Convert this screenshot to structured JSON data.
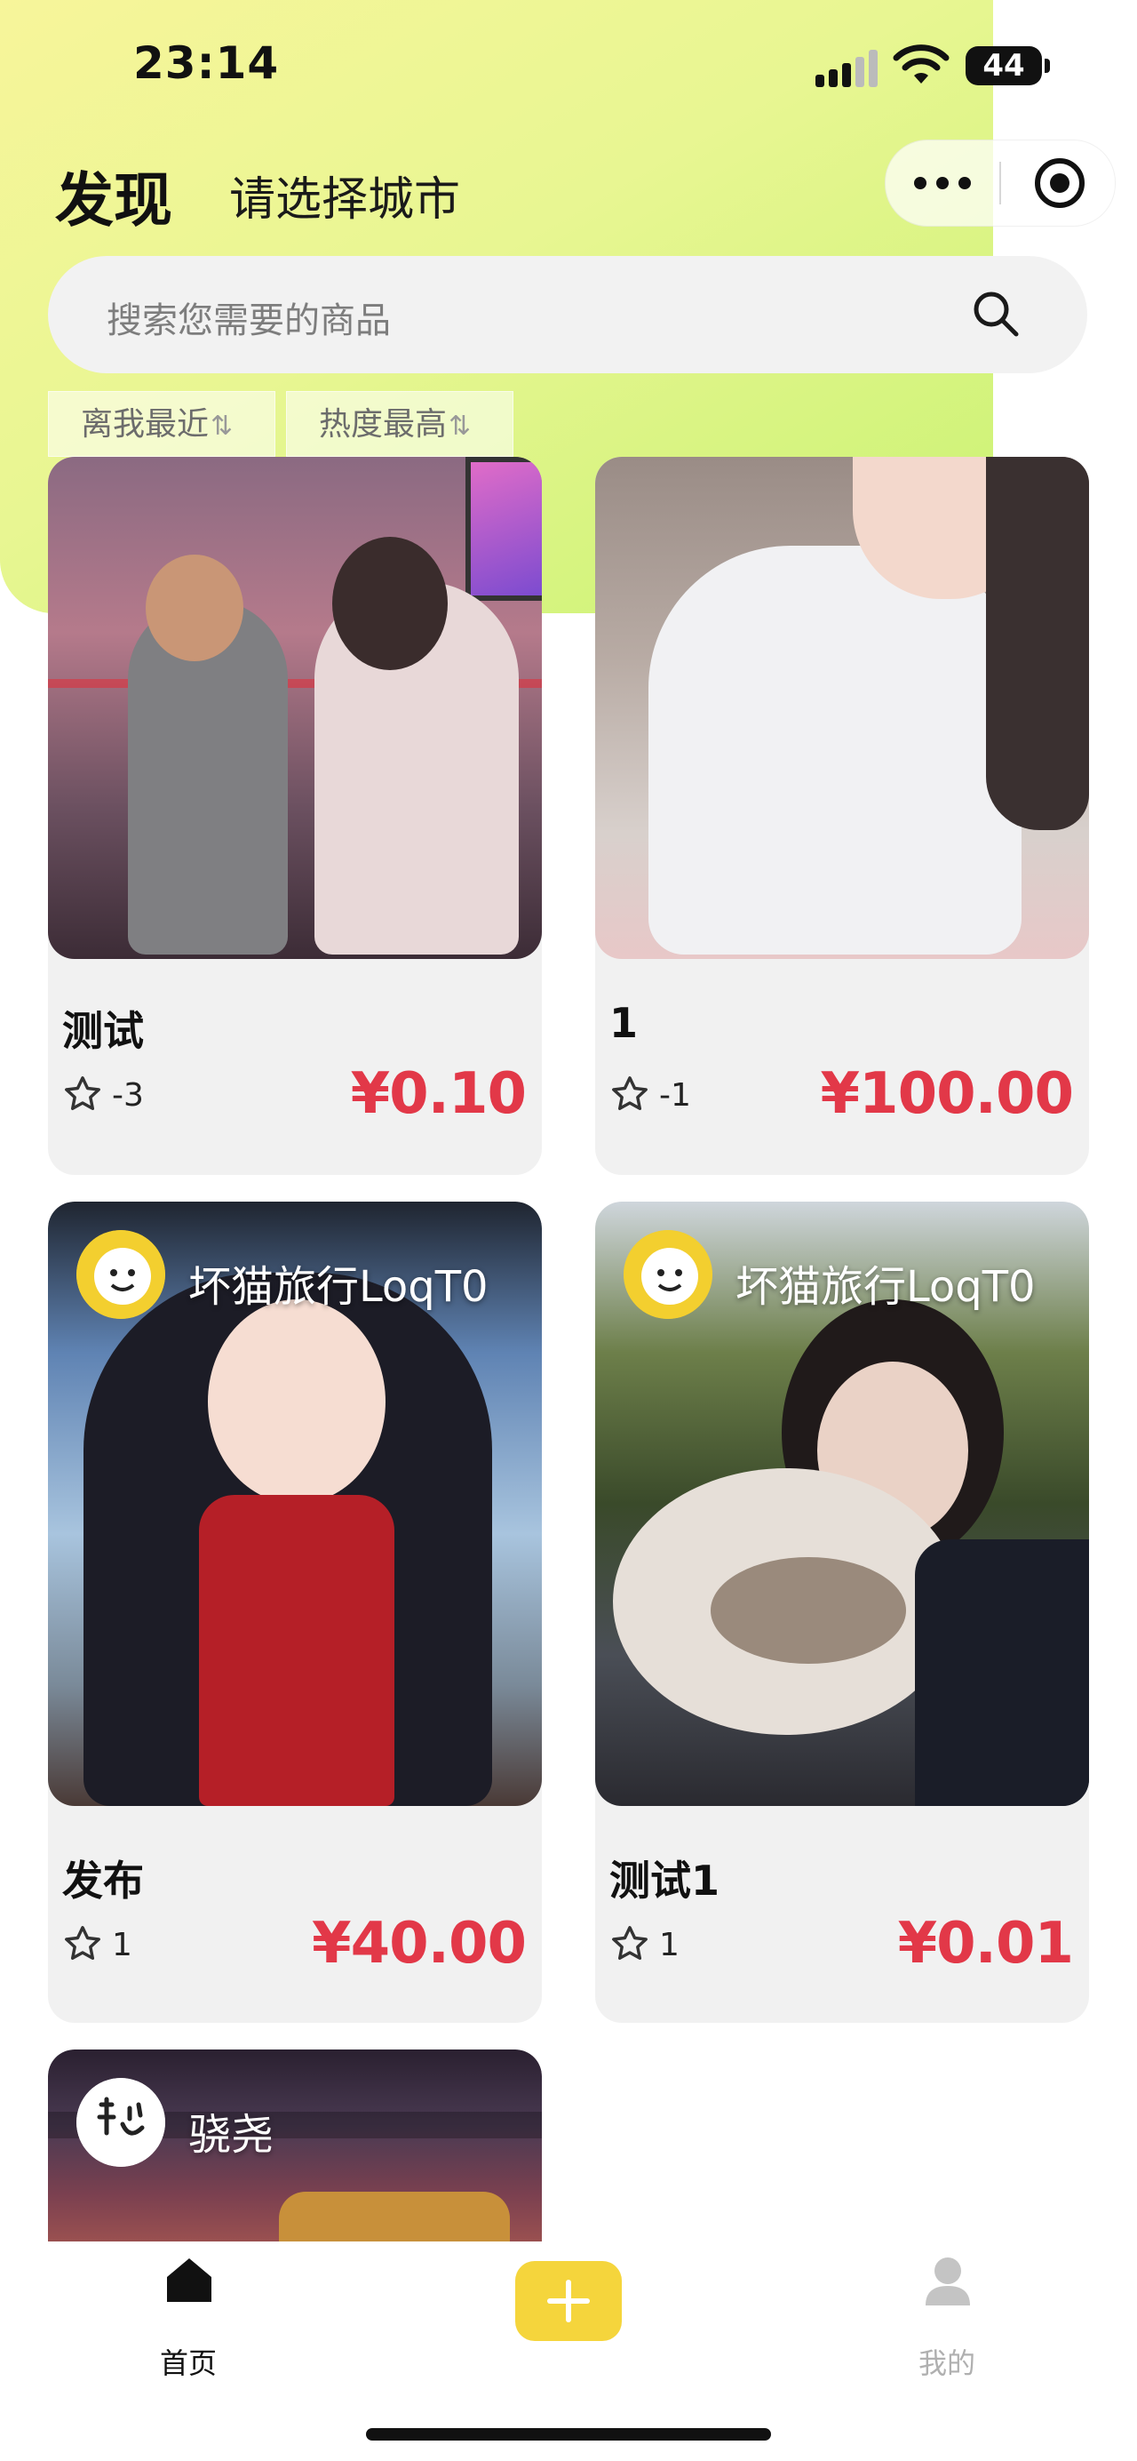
{
  "status_bar": {
    "time": "23:14",
    "battery": "44"
  },
  "header": {
    "title": "发现",
    "city": "请选择城市"
  },
  "search": {
    "placeholder": "搜索您需要的商品"
  },
  "sort": {
    "nearest": "离我最近",
    "hottest": "热度最高"
  },
  "items": [
    {
      "title": "测试",
      "likes": "-3",
      "price": "¥0.10"
    },
    {
      "title": "1",
      "likes": "-1",
      "price": "¥100.00"
    },
    {
      "author": "坏猫旅行LoqT0",
      "title": "发布",
      "likes": "1",
      "price": "¥40.00"
    },
    {
      "author": "坏猫旅行LoqT0",
      "title": "测试1",
      "likes": "1",
      "price": "¥0.01"
    },
    {
      "author": "骁尧"
    }
  ],
  "tabbar": {
    "home": "首页",
    "mine": "我的"
  },
  "colors": {
    "price": "#e23848",
    "accent": "#f5d53c",
    "header_gradient_end": "#c9f272"
  }
}
